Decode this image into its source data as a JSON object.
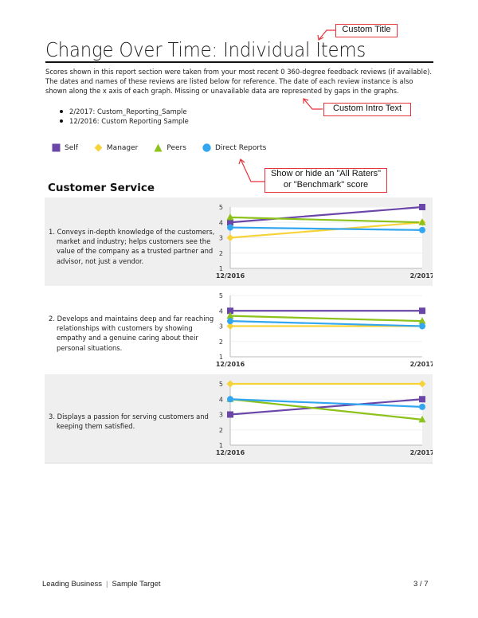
{
  "header": {
    "title": "Change Over Time: Individual Items",
    "intro": "Scores shown in this report section were taken from your most recent 0 360-degree feedback reviews (if available). The dates and names of these reviews are listed below for reference. The date of each review instance is also shown along the x axis of each graph. Missing or unavailable data are represented by gaps in the graphs.",
    "reviews": [
      "2/2017: Custom_Reporting_Sample",
      "12/2016: Custom Reporting Sample"
    ]
  },
  "legend": [
    {
      "name": "Self",
      "shape": "square",
      "color": "#6a46a8"
    },
    {
      "name": "Manager",
      "shape": "diamond",
      "color": "#f7d33a"
    },
    {
      "name": "Peers",
      "shape": "triangle",
      "color": "#8cc21a"
    },
    {
      "name": "Direct Reports",
      "shape": "circle",
      "color": "#33a6f0"
    }
  ],
  "annotations": {
    "custom_title": "Custom Title",
    "custom_intro": "Custom Intro Text",
    "benchmark_line1": "Show or hide an \"All Raters\"",
    "benchmark_line2": "or \"Benchmark\" score"
  },
  "section": {
    "title": "Customer Service"
  },
  "chart_data": [
    {
      "type": "line",
      "item": "1. Conveys in-depth knowledge of the customers, market and industry; helps customers see the value of the company as a trusted partner and advisor, not just a vendor.",
      "x": [
        "12/2016",
        "2/2017"
      ],
      "ylim": [
        1,
        5
      ],
      "yticks": [
        "1",
        "2",
        "3",
        "4",
        "5"
      ],
      "series": [
        {
          "name": "Self",
          "values": [
            4,
            5
          ]
        },
        {
          "name": "Manager",
          "values": [
            3,
            4
          ]
        },
        {
          "name": "Peers",
          "values": [
            4.33,
            4
          ]
        },
        {
          "name": "Direct Reports",
          "values": [
            3.67,
            3.5
          ]
        }
      ]
    },
    {
      "type": "line",
      "item": "2. Develops and maintains deep and far reaching relationships with customers by showing empathy and a genuine caring about their personal situations.",
      "x": [
        "12/2016",
        "2/2017"
      ],
      "ylim": [
        1,
        5
      ],
      "yticks": [
        "1",
        "2",
        "3",
        "4",
        "5"
      ],
      "series": [
        {
          "name": "Self",
          "values": [
            4,
            4
          ]
        },
        {
          "name": "Manager",
          "values": [
            3,
            3
          ]
        },
        {
          "name": "Peers",
          "values": [
            3.67,
            3.33
          ]
        },
        {
          "name": "Direct Reports",
          "values": [
            3.33,
            3
          ]
        }
      ]
    },
    {
      "type": "line",
      "item": "3. Displays a passion for serving customers and keeping them satisfied.",
      "x": [
        "12/2016",
        "2/2017"
      ],
      "ylim": [
        1,
        5
      ],
      "yticks": [
        "1",
        "2",
        "3",
        "4",
        "5"
      ],
      "series": [
        {
          "name": "Self",
          "values": [
            3,
            4
          ]
        },
        {
          "name": "Manager",
          "values": [
            5,
            5
          ]
        },
        {
          "name": "Peers",
          "values": [
            4,
            2.67
          ]
        },
        {
          "name": "Direct Reports",
          "values": [
            4,
            3.5
          ]
        }
      ]
    }
  ],
  "footer": {
    "company": "Leading Business",
    "target": "Sample Target",
    "page": "3 / 7"
  }
}
